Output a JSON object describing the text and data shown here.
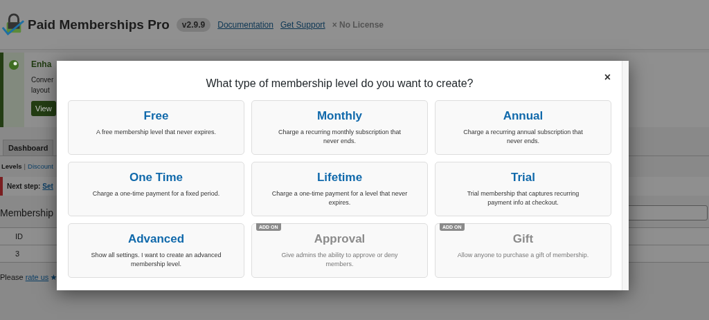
{
  "header": {
    "title": "Paid Memberships Pro",
    "version": "v2.9.9",
    "links": [
      "Documentation",
      "Get Support"
    ],
    "license": "× No License"
  },
  "notice": {
    "title": "Enha",
    "text_lines": [
      "Conver",
      "layout"
    ],
    "button": "View"
  },
  "tabs": [
    {
      "label": "Dashboard",
      "selected": false
    }
  ],
  "subnav": {
    "separator": "|",
    "items": [
      {
        "label": "Levels",
        "selected": true
      },
      {
        "label": "Discount",
        "selected": false
      }
    ]
  },
  "next_step": {
    "label": "Next step:",
    "link": "Set"
  },
  "page_heading": "Membership",
  "table": {
    "columns": [
      "ID"
    ],
    "rows": [
      [
        "3"
      ]
    ]
  },
  "footer": {
    "text": "Please",
    "link": "rate us"
  },
  "modal": {
    "title": "What type of membership level do you want to create?",
    "close": "×",
    "cards": [
      {
        "kind": "level",
        "title": "Free",
        "description": "A free membership level that never expires."
      },
      {
        "kind": "level",
        "title": "Monthly",
        "description": "Charge a recurring monthly subscription that never ends."
      },
      {
        "kind": "level",
        "title": "Annual",
        "description": "Charge a recurring annual subscription that never ends."
      },
      {
        "kind": "level",
        "title": "One Time",
        "description": "Charge a one-time payment for a fixed period."
      },
      {
        "kind": "level",
        "title": "Lifetime",
        "description": "Charge a one-time payment for a level that never expires."
      },
      {
        "kind": "level",
        "title": "Trial",
        "description": "Trial membership that captures recurring payment info at checkout."
      },
      {
        "kind": "level",
        "title": "Advanced",
        "description": "Show all settings. I want to create an advanced membership level."
      },
      {
        "kind": "addon",
        "badge": "ADD ON",
        "title": "Approval",
        "description": "Give admins the ability to approve or deny members."
      },
      {
        "kind": "addon",
        "badge": "ADD ON",
        "title": "Gift",
        "description": "Allow anyone to purchase a gift of membership."
      }
    ]
  }
}
